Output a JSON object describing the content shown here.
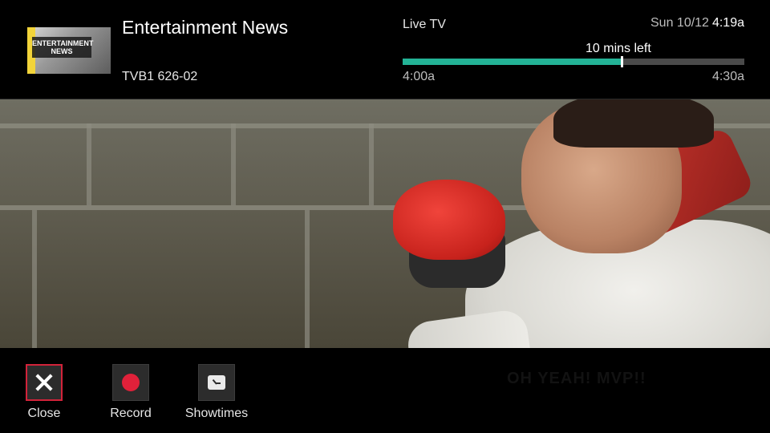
{
  "program": {
    "title": "Entertainment News",
    "channel": "TVB1 626-02",
    "thumbnail_text": "ENTERTAINMENT NEWS"
  },
  "status": {
    "source": "Live TV",
    "date": "Sun 10/12",
    "time": "4:19a",
    "remaining": "10 mins left",
    "start_time": "4:00a",
    "end_time": "4:30a",
    "progress_fraction": 0.64
  },
  "actions": [
    {
      "label": "Close",
      "icon": "close-icon"
    },
    {
      "label": "Record",
      "icon": "record-icon"
    },
    {
      "label": "Showtimes",
      "icon": "clock-icon"
    }
  ],
  "video": {
    "caption": "OH YEAH! MVP!!"
  },
  "colors": {
    "progress": "#23b396",
    "focus": "#d2233a",
    "record": "#e0213a"
  }
}
